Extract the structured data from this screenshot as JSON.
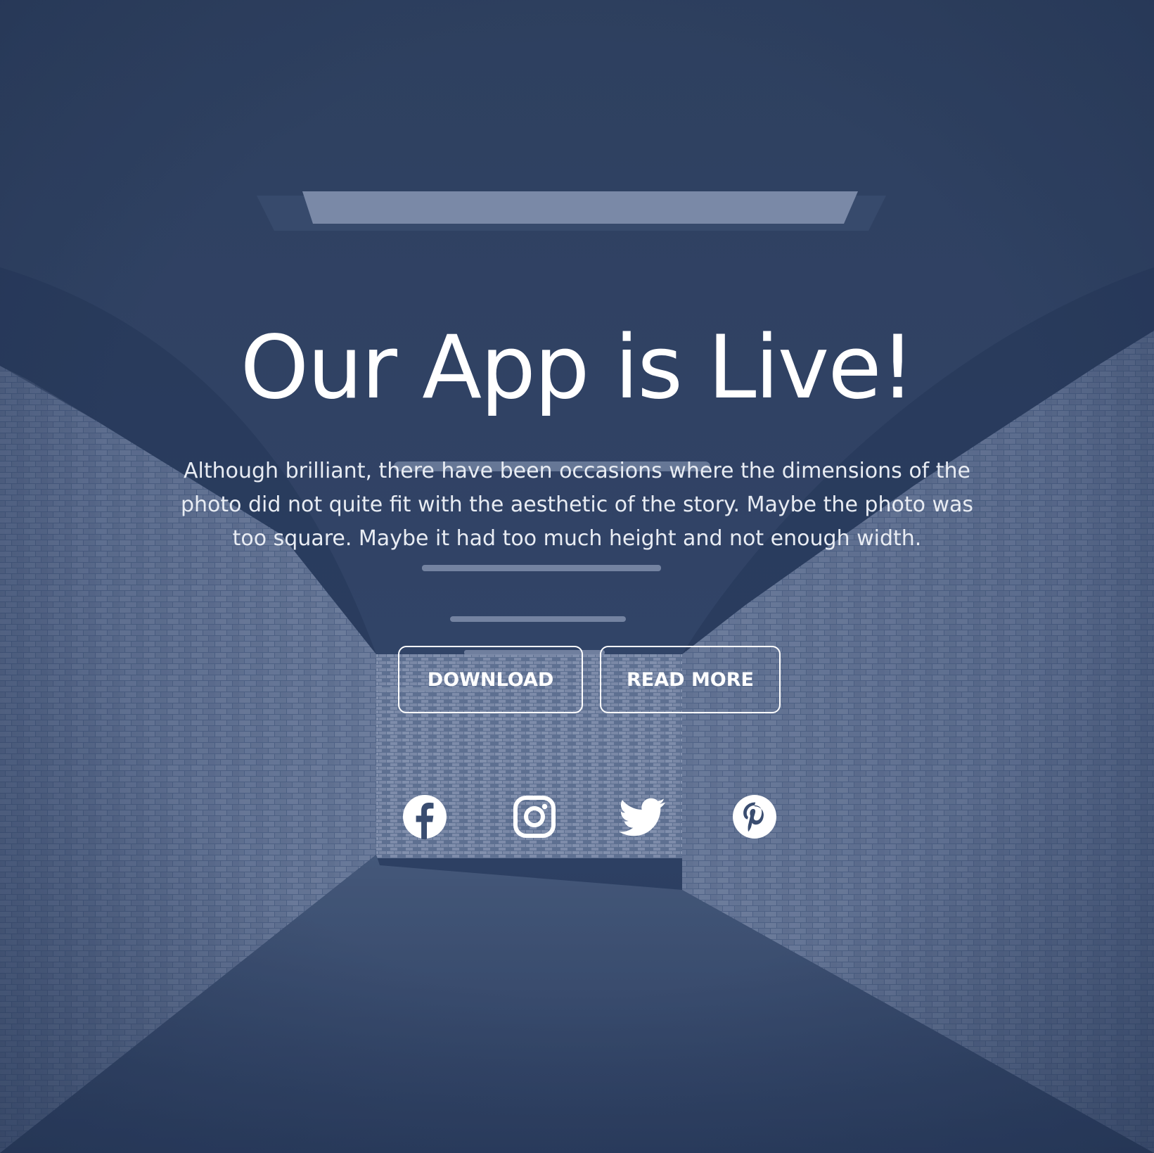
{
  "hero": {
    "title": "Our App is Live!",
    "description": "Although brilliant, there have been occasions where the dimensions of the photo did not quite fit with the aesthetic of the story. Maybe the photo was too square. Maybe it had too much height and not enough width.",
    "buttons": {
      "download_label": "DOWNLOAD",
      "read_more_label": "READ MORE"
    },
    "social": [
      {
        "icon": "facebook-icon"
      },
      {
        "icon": "instagram-icon"
      },
      {
        "icon": "twitter-icon"
      },
      {
        "icon": "pinterest-icon"
      }
    ]
  },
  "colors": {
    "overlay": "#2c3e5c",
    "text": "#ffffff",
    "button_border": "#ffffff"
  }
}
